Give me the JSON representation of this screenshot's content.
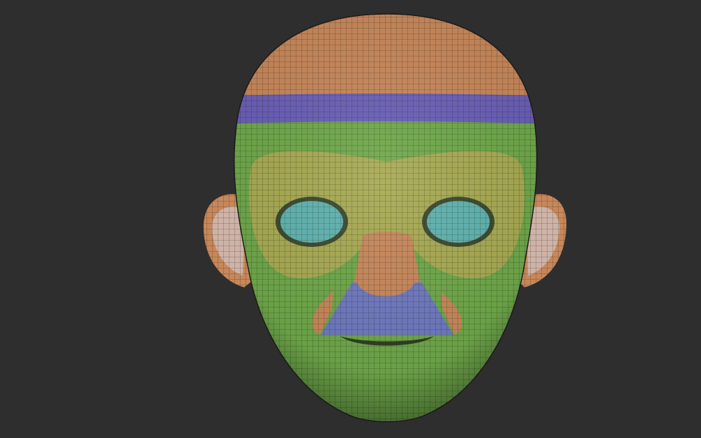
{
  "viewport": {
    "background": "#2e2e2e",
    "model": "head-mesh-polygroups"
  },
  "polygroup_colors": {
    "scalp": "#c8875a",
    "brow_band": "#6a5fb8",
    "face": "#6fa84a",
    "eye_mask": "#a8aa52",
    "eye_socket": "#5fb3b0",
    "nose": "#c8875a",
    "upper_lip": "#6f79c0",
    "ear_outer": "#c8875a",
    "ear_inner": "#cfb3a8",
    "wire": "#1e2a14"
  }
}
